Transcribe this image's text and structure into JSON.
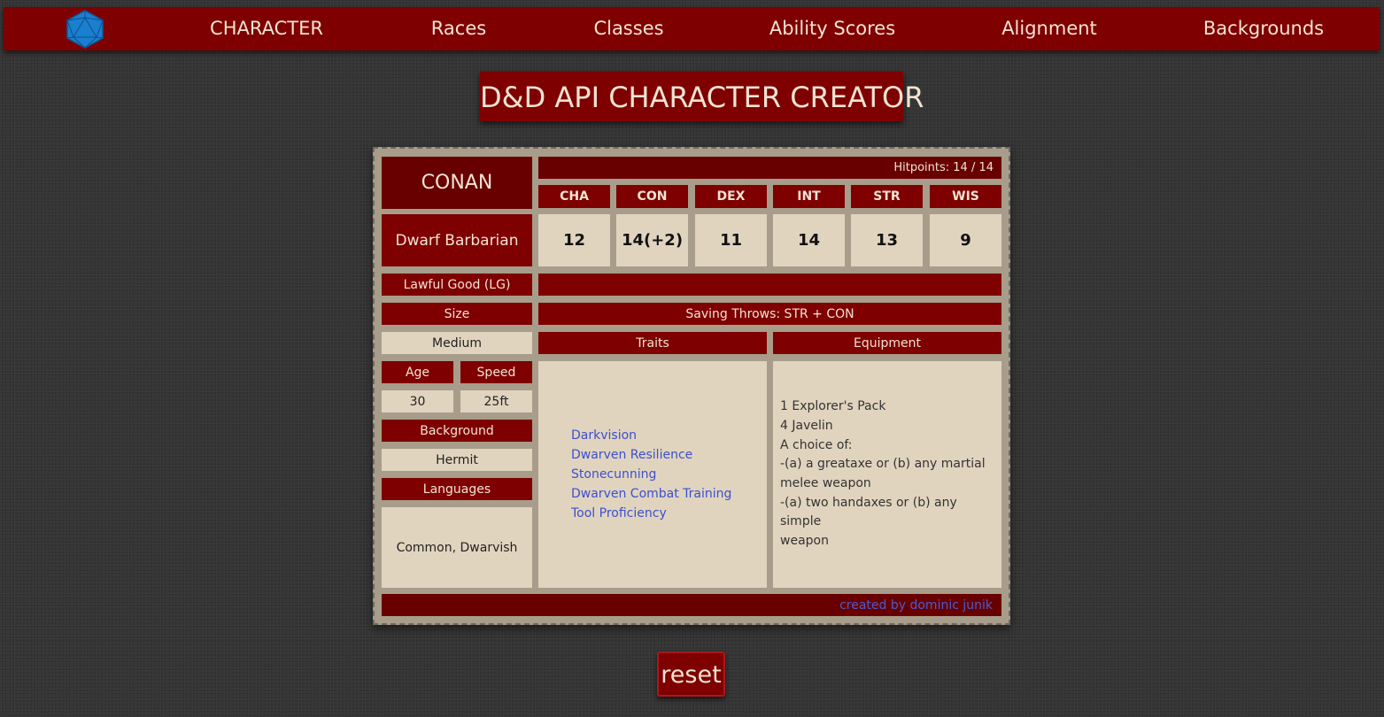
{
  "nav": {
    "logo_icon": "d20-die-icon",
    "items": [
      "CHARACTER",
      "Races",
      "Classes",
      "Ability Scores",
      "Alignment",
      "Backgrounds"
    ]
  },
  "title": "D&D API CHARACTER CREATOR",
  "sheet": {
    "name": "CONAN",
    "race_class": "Dwarf Barbarian",
    "alignment": "Lawful Good (LG)",
    "hitpoints": "Hitpoints: 14 / 14",
    "stats": [
      {
        "label": "CHA",
        "value": "12"
      },
      {
        "label": "CON",
        "value": "14(+2)"
      },
      {
        "label": "DEX",
        "value": "11"
      },
      {
        "label": "INT",
        "value": "14"
      },
      {
        "label": "STR",
        "value": "13"
      },
      {
        "label": "WIS",
        "value": "9"
      }
    ],
    "size_label": "Size",
    "size_value": "Medium",
    "age_label": "Age",
    "age_value": "30",
    "speed_label": "Speed",
    "speed_value": "25ft",
    "background_label": "Background",
    "background_value": "Hermit",
    "languages_label": "Languages",
    "languages_value": "Common, Dwarvish",
    "saving_throws": "Saving Throws: STR + CON",
    "traits_label": "Traits",
    "traits": [
      "Darkvision",
      "Dwarven Resilience",
      "Stonecunning",
      "Dwarven Combat Training",
      "Tool Proficiency"
    ],
    "equipment_label": "Equipment",
    "equipment": [
      "1 Explorer's Pack",
      "4 Javelin",
      "A choice of:",
      "-(a) a greataxe or (b) any martial",
      "melee weapon",
      "-(a) two handaxes or (b) any simple",
      "weapon"
    ],
    "credit": "created by dominic junik"
  },
  "reset_label": "reset",
  "colors": {
    "primary_red": "#7e0000",
    "parchment": "#e1d4bf",
    "link_blue": "#3b4fd0",
    "background": "#353535"
  }
}
